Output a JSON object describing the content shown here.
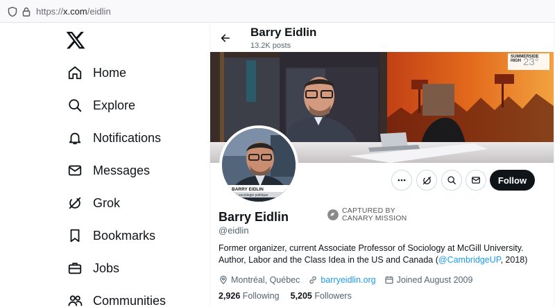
{
  "browser": {
    "url_prefix": "https://",
    "url_host": "x.com",
    "url_path": "/eidlin"
  },
  "nav": {
    "items": [
      {
        "label": "Home",
        "icon": "home-icon"
      },
      {
        "label": "Explore",
        "icon": "search-icon"
      },
      {
        "label": "Notifications",
        "icon": "bell-icon"
      },
      {
        "label": "Messages",
        "icon": "envelope-icon"
      },
      {
        "label": "Grok",
        "icon": "grok-icon"
      },
      {
        "label": "Bookmarks",
        "icon": "bookmark-icon"
      },
      {
        "label": "Jobs",
        "icon": "briefcase-icon"
      },
      {
        "label": "Communities",
        "icon": "people-icon"
      }
    ]
  },
  "header": {
    "name": "Barry Eidlin",
    "posts": "13.2K posts"
  },
  "banner": {
    "weather_place": "SUMMERSIDE",
    "weather_label": "HIGH",
    "weather_value": "23°"
  },
  "avatar": {
    "caption_name": "BARRY EIDLIN",
    "caption_sub": "r de sociologie politique"
  },
  "actions": {
    "follow_label": "Follow"
  },
  "profile": {
    "name": "Barry Eidlin",
    "handle": "@eidlin",
    "canary_line1": "CAPTURED BY",
    "canary_line2": "CANARY MISSION",
    "bio_line1": "Former organizer, current Associate Professor of Sociology at McGill University.",
    "bio_line2_pre": "Author, Labor and the Class Idea in the US and Canada (",
    "bio_link": "@CambridgeUP",
    "bio_line2_post": ", 2018)",
    "location": "Montréal, Québec",
    "website": "barryeidlin.org",
    "joined": "Joined August 2009",
    "following_count": "2,926",
    "following_label": "Following",
    "followers_count": "5,205",
    "followers_label": "Followers"
  },
  "colors": {
    "accent": "#1d9bf0",
    "text": "#0f1419",
    "muted": "#536471"
  }
}
